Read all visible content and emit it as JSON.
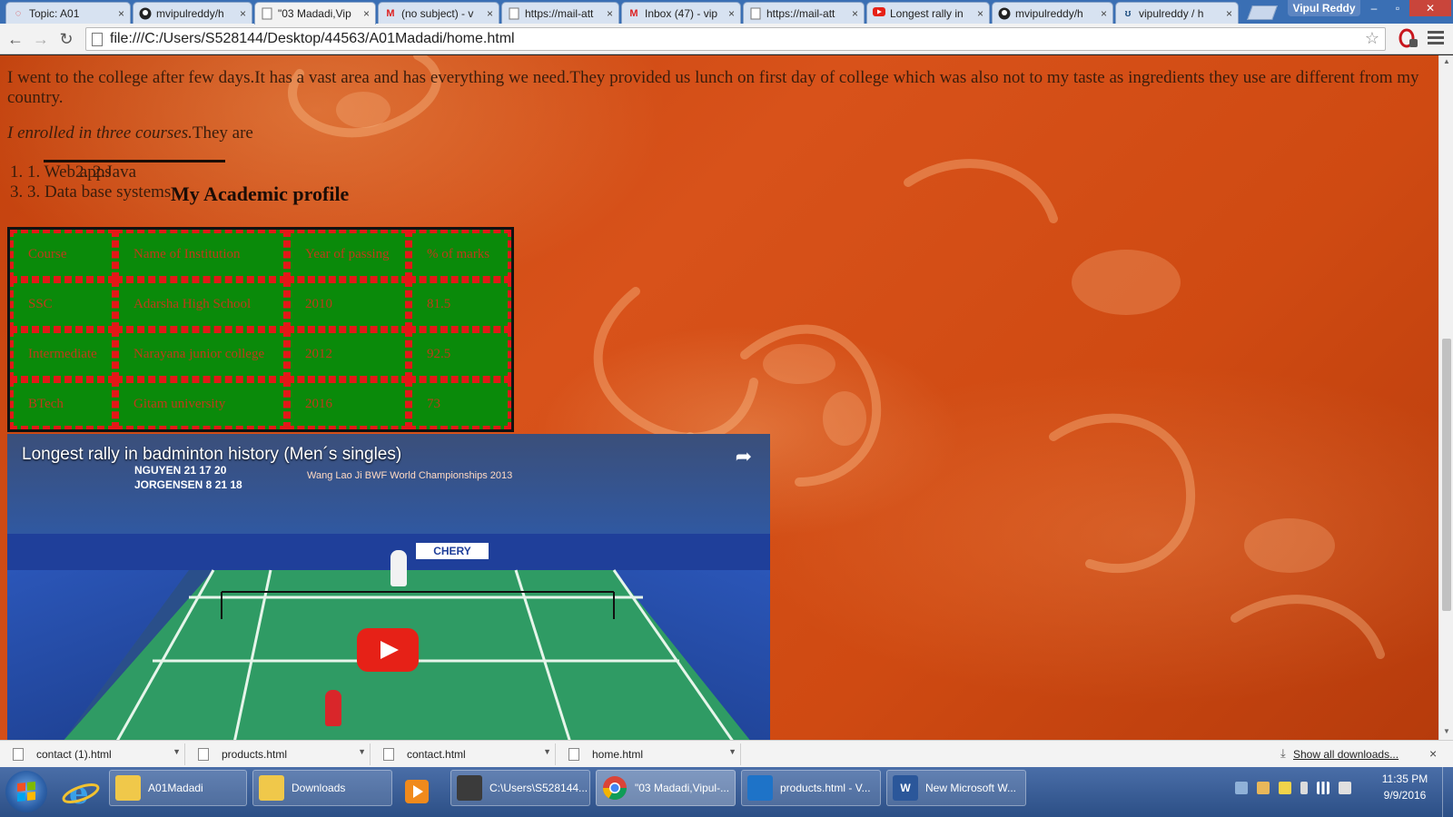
{
  "browser": {
    "tabs": [
      {
        "title": "Topic: A01",
        "icon": "spinner-icon",
        "active": false
      },
      {
        "title": "mvipulreddy/h",
        "icon": "github-icon",
        "active": false
      },
      {
        "title": "\"03 Madadi,Vip",
        "icon": "page-icon",
        "active": true
      },
      {
        "title": "(no subject) - v",
        "icon": "gmail-icon",
        "active": false
      },
      {
        "title": "https://mail-att",
        "icon": "page-icon",
        "active": false
      },
      {
        "title": "Inbox (47) - vip",
        "icon": "gmail-icon",
        "active": false
      },
      {
        "title": "https://mail-att",
        "icon": "page-icon",
        "active": false
      },
      {
        "title": "Longest rally in",
        "icon": "youtube-icon",
        "active": false
      },
      {
        "title": "mvipulreddy/h",
        "icon": "github-icon",
        "active": false
      },
      {
        "title": "vipulreddy / h",
        "icon": "page-icon",
        "active": false
      }
    ],
    "profile_name": "Vipul Reddy",
    "url": "file:///C:/Users/S528144/Desktop/44563/A01Madadi/home.html",
    "tab_close_glyph": "×",
    "window_controls": {
      "minimize": "–",
      "maximize": "▫",
      "close": "✕"
    }
  },
  "page": {
    "paragraph": "I went to the college after few days.It has a vast area and has everything we need.They provided us lunch on first day of college which was also not to my taste as ingredients they use are different from my country.",
    "enroll_italic": "I enrolled in three courses.",
    "enroll_rest": "They are",
    "courses": [
      {
        "marker": "1.",
        "text": "Web apps"
      },
      {
        "marker": "2.",
        "text": "Java"
      },
      {
        "marker": "3.",
        "text": "Data base systems"
      }
    ],
    "profile_heading": "My Academic profile",
    "table": {
      "headers": [
        "Course",
        "Name of Institution",
        "Year of passing",
        "% of marks"
      ],
      "rows": [
        [
          "SSC",
          "Adarsha High School",
          "2010",
          "81.5"
        ],
        [
          "Intermediate",
          "Narayana junior college",
          "2012",
          "92.5"
        ],
        [
          "BTech",
          "Gitam university",
          "2016",
          "73"
        ]
      ]
    },
    "video": {
      "title": "Longest rally in badminton history (Men´s singles)",
      "score_line_1": "NGUYEN         21 17 20",
      "score_line_2": "JORGENSEN       8 21 18",
      "banner_text": "Wang Lao Ji BWF World Championships 2013",
      "board_text": "CHERY"
    }
  },
  "downloads": {
    "items": [
      "contact (1).html",
      "products.html",
      "contact.html",
      "home.html"
    ],
    "show_all": "Show all downloads...",
    "close": "×"
  },
  "taskbar": {
    "items": [
      {
        "label": "A01Madadi",
        "icon": "folder-icon",
        "active": false
      },
      {
        "label": "Downloads",
        "icon": "folder-icon",
        "active": false
      },
      {
        "label": "C:\\Users\\S528144...",
        "icon": "sublime-icon",
        "active": false
      },
      {
        "label": "\"03 Madadi,Vipul-...",
        "icon": "chrome-icon",
        "active": true
      },
      {
        "label": "products.html - V...",
        "icon": "vscode-icon",
        "active": false
      },
      {
        "label": "New Microsoft W...",
        "icon": "word-icon",
        "active": false
      }
    ],
    "time": "11:35 PM",
    "date": "9/9/2016"
  },
  "colors": {
    "page_background": "#c9470f",
    "table_background": "#0a8a0a",
    "table_border": "#e31818",
    "table_text": "#c03a1a",
    "taskbar": "#2c4f86"
  }
}
